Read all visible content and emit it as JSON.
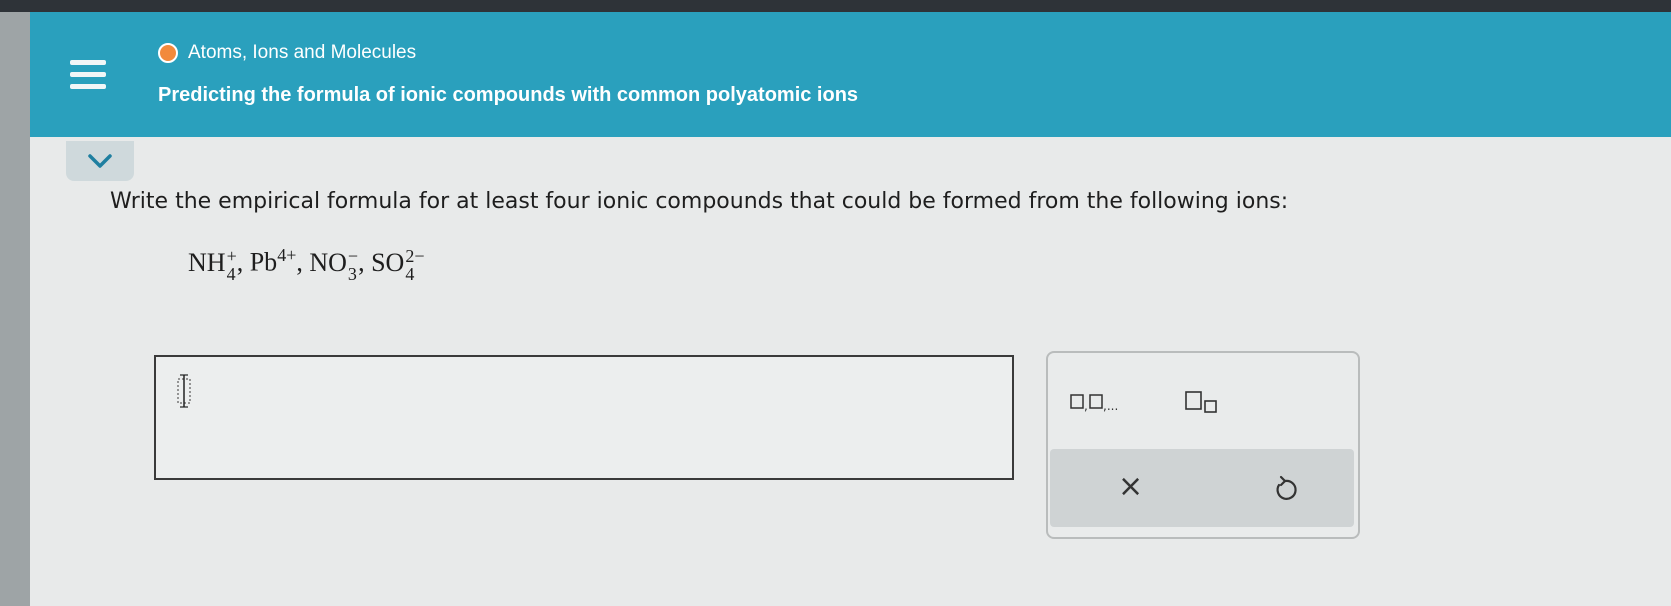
{
  "header": {
    "topic": "Atoms, Ions and Molecules",
    "lesson_title": "Predicting the formula of ionic compounds with common polyatomic ions",
    "accent_color": "#2aa0bd",
    "topic_dot_color": "#f28a3c"
  },
  "question": {
    "prompt": "Write the empirical formula for at least four ionic compounds that could be formed from the following ions:",
    "ions": [
      {
        "base": "NH",
        "sub": "4",
        "sup": "+"
      },
      {
        "base": "Pb",
        "sub": "",
        "sup": "4+"
      },
      {
        "base": "NO",
        "sub": "3",
        "sup": "−"
      },
      {
        "base": "SO",
        "sub": "4",
        "sup": "2−"
      }
    ]
  },
  "answer": {
    "value": ""
  },
  "tools": {
    "list_template_icon": "comma-separated-boxes-icon",
    "list_template_text": "□,□,...",
    "subscript_template_icon": "subscript-box-icon",
    "clear_icon": "x-icon",
    "clear_glyph": "×",
    "undo_icon": "undo-arrow-icon",
    "undo_glyph": "↺"
  },
  "icons": {
    "menu": "hamburger-menu-icon",
    "collapse": "chevron-down-icon"
  }
}
